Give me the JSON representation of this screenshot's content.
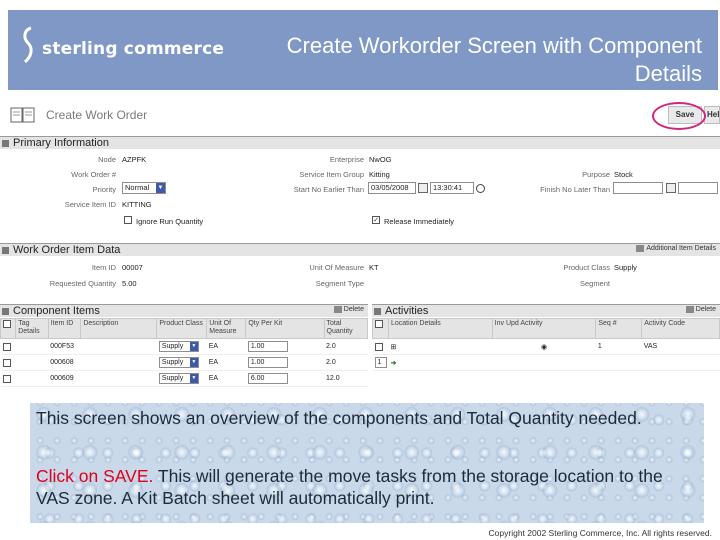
{
  "header": {
    "logo_text": "sterling commerce",
    "slide_title": "Create Workorder Screen with Component Details"
  },
  "screen": {
    "page_title": "Create Work Order",
    "save_label": "Save",
    "help_label": "Help",
    "primary_info": {
      "title": "Primary Information",
      "node_label": "Node",
      "node_value": "AZPFK",
      "enterprise_label": "Enterprise",
      "enterprise_value": "NwOG",
      "work_order_label": "Work Order #",
      "service_group_label": "Service Item Group",
      "service_group_value": "Kitting",
      "purpose_label": "Purpose",
      "purpose_value": "Stock",
      "priority_label": "Priority",
      "priority_value": "Normal",
      "start_label": "Start No Earlier Than",
      "start_date": "03/05/2008",
      "start_time": "13:30:41",
      "finish_label": "Finish No Later Than",
      "service_item_label": "Service Item ID",
      "service_item_value": "KITTING",
      "ignore_run_label": "Ignore Run Quantity",
      "release_label": "Release Immediately"
    },
    "item_data": {
      "title": "Work Order Item Data",
      "additional_link": "Additional Item Details",
      "item_id_label": "Item ID",
      "item_id_value": "00007",
      "uom_label": "Unit Of Measure",
      "uom_value": "KT",
      "product_class_label": "Product Class",
      "product_class_value": "Supply",
      "req_qty_label": "Requested Quantity",
      "req_qty_value": "5.00",
      "segment_type_label": "Segment Type",
      "segment_label": "Segment"
    },
    "components": {
      "title": "Component Items",
      "delete_label": "Delete",
      "headers": [
        "Tag Details",
        "Item ID",
        "Description",
        "Product Class",
        "Unit Of Measure",
        "Qty Per Kit",
        "Total Quantity"
      ],
      "rows": [
        {
          "item": "000F53",
          "class": "Supply",
          "uom": "EA",
          "qty": "1.00",
          "total": "2.0"
        },
        {
          "item": "000608",
          "class": "Supply",
          "uom": "EA",
          "qty": "1.00",
          "total": "2.0"
        },
        {
          "item": "000609",
          "class": "Supply",
          "uom": "EA",
          "qty": "6.00",
          "total": "12.0"
        }
      ]
    },
    "activities": {
      "title": "Activities",
      "delete_label": "Delete",
      "headers": [
        "Location Details",
        "Inv Upd Activity",
        "Seq #",
        "Activity Code"
      ],
      "rows": [
        {
          "seq": "1",
          "code": "VAS"
        }
      ],
      "new_seq": "1"
    }
  },
  "note": {
    "line1": "This screen shows an overview of the components and Total Quantity needed.",
    "click_save": "Click on SAVE.",
    "line2_rest": " This will generate the move tasks from the storage location to the VAS zone.  A Kit Batch sheet will automatically print."
  },
  "copyright": "Copyright 2002 Sterling Commerce, Inc. All rights reserved."
}
